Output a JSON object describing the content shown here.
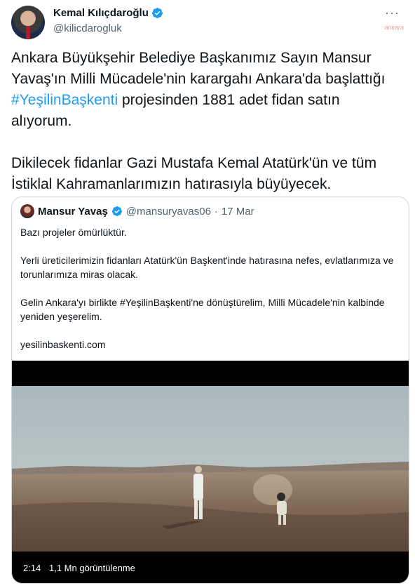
{
  "tweet": {
    "author_name": "Kemal Kılıçdaroğlu",
    "author_handle": "@kilicdarogluk",
    "more_icon": "more-horizontal-icon",
    "watermark": "ankara",
    "text_line1": "Ankara Büyükşehir Belediye Başkanımız Sayın Mansur Yavaş'ın Milli Mücadele'nin karargahı Ankara'da başlattığı ",
    "hashtag": "#YeşilinBaşkenti",
    "text_line1_end": " projesinden 1881 adet fidan satın alıyorum.",
    "text_para2": "Dikilecek fidanlar Gazi Mustafa Kemal Atatürk'ün ve tüm İstiklal Kahramanlarımızın hatırasıyla büyüyecek."
  },
  "quote": {
    "author_name": "Mansur Yavaş",
    "author_handle": "@mansuryavas06",
    "separator": "·",
    "date": "17 Mar",
    "p1": "Bazı projeler ömürlüktür.",
    "p2": "Yerli üreticilerimizin fidanları Atatürk'ün Başkent'inde hatırasına nefes, evlatlarımıza ve torunlarımıza miras olacak.",
    "p3": "Gelin Ankara'yı birlikte #YeşilinBaşkenti'ne dönüştürelim, Milli Mücadele'nin kalbinde yeniden yeşerelim.",
    "link": "yesilinbaskenti.com"
  },
  "video": {
    "duration": "2:14",
    "views": "1,1 Mn görüntülenme"
  },
  "colors": {
    "accent": "#1d9bf0",
    "text": "#0f1419",
    "muted": "#536471",
    "border": "#cfd9de"
  }
}
